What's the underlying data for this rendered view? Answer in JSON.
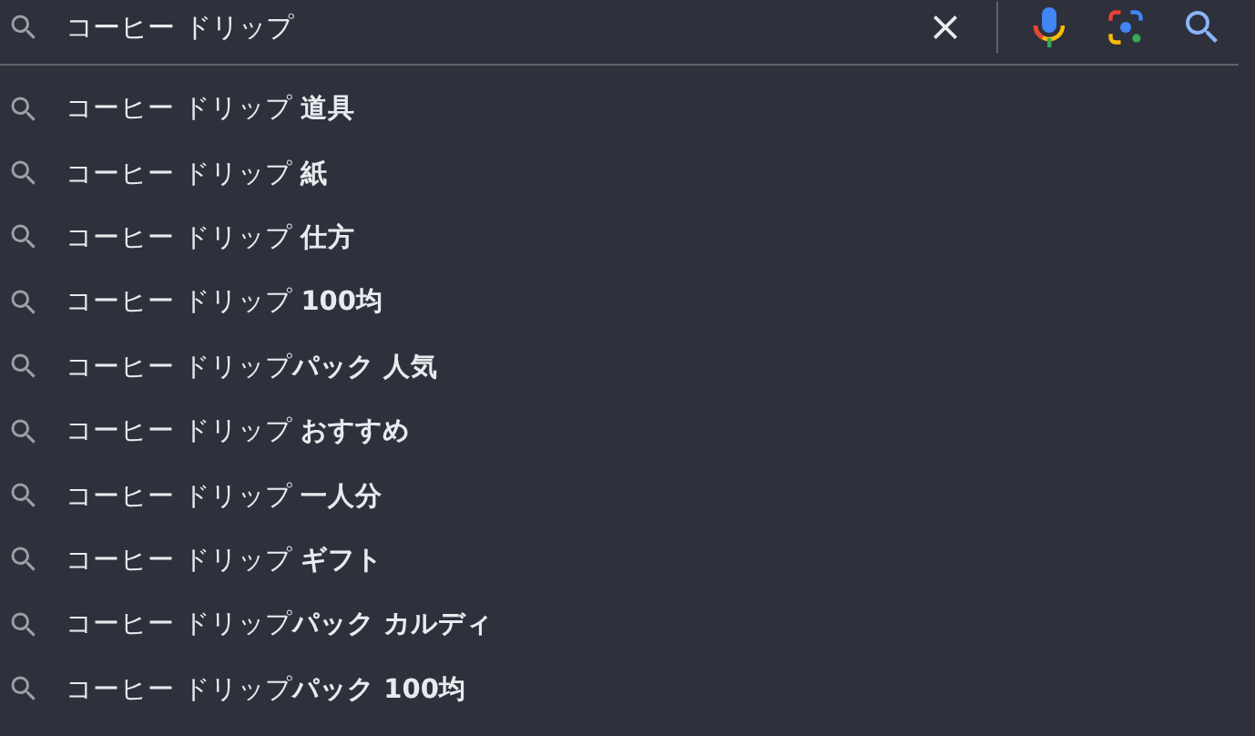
{
  "search": {
    "value": "コーヒー ドリップ"
  },
  "suggestions": [
    {
      "text": "コーヒー ドリップ **道具**"
    },
    {
      "text": "コーヒー ドリップ **紙**"
    },
    {
      "text": "コーヒー ドリップ **仕方**"
    },
    {
      "text": "コーヒー ドリップ **100均**"
    },
    {
      "text": "コーヒー ドリップ**パック 人気**"
    },
    {
      "text": "コーヒー ドリップ **おすすめ**"
    },
    {
      "text": "コーヒー ドリップ **一人分**"
    },
    {
      "text": "コーヒー ドリップ **ギフト**"
    },
    {
      "text": "コーヒー ドリップ**パック カルディ**"
    },
    {
      "text": "コーヒー ドリップ**パック 100均**"
    }
  ]
}
